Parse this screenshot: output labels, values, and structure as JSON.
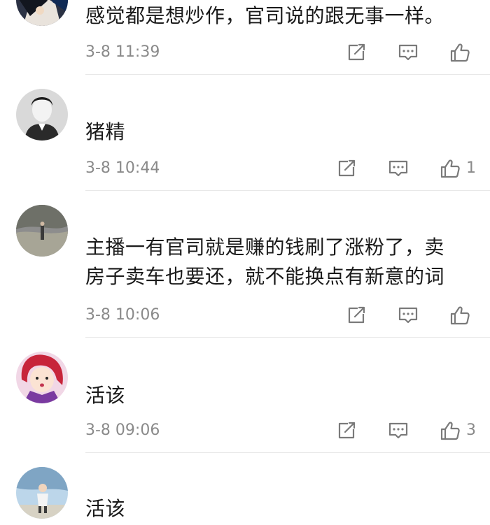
{
  "comments": [
    {
      "lines": [
        "感觉都是想炒作，官司说的跟无事一样。"
      ],
      "time": "3-8 11:39",
      "likes": ""
    },
    {
      "lines": [
        "猪精"
      ],
      "time": "3-8 10:44",
      "likes": "1"
    },
    {
      "lines": [
        "主播一有官司就是赚的钱刷了涨粉了，卖",
        "房子卖车也要还，就不能换点有新意的词"
      ],
      "time": "3-8 10:06",
      "likes": ""
    },
    {
      "lines": [
        "活该"
      ],
      "time": "3-8 09:06",
      "likes": "3"
    },
    {
      "lines": [
        "活该"
      ],
      "time": "",
      "likes": ""
    }
  ],
  "icons": {
    "share": "share-icon",
    "reply": "comment-icon",
    "like": "thumbs-up-icon"
  },
  "colors": {
    "text": "#1a1a1a",
    "meta": "#8a8a8a",
    "icon": "#7a7a7a",
    "divider": "#e8e8e8"
  }
}
